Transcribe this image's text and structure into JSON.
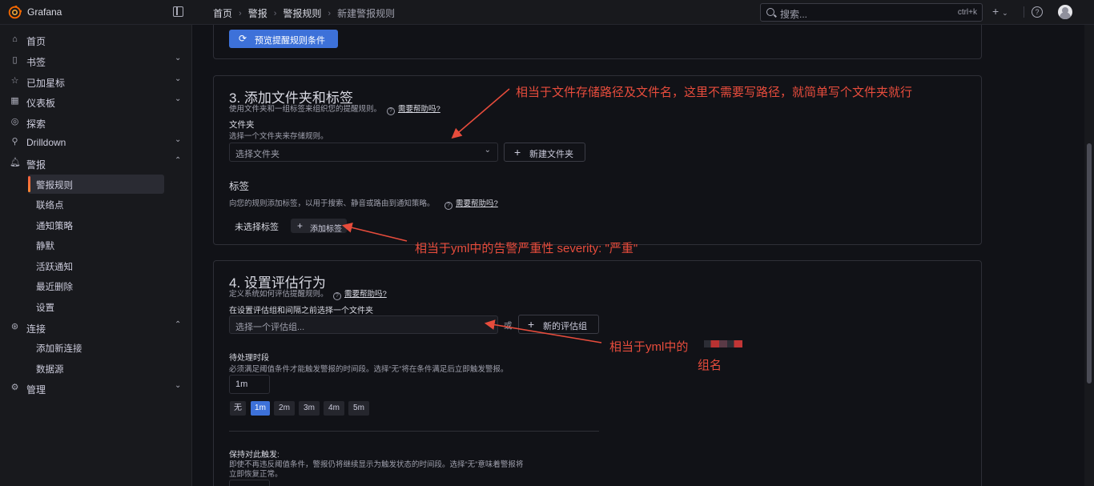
{
  "topbar": {
    "brand": "Grafana",
    "breadcrumb": [
      "首页",
      "警报",
      "警报规则",
      "新建警报规则"
    ],
    "search_placeholder": "搜索...",
    "search_shortcut": "ctrl+k",
    "plus_label": "+",
    "help_label": "?"
  },
  "sidebar": {
    "items": [
      {
        "label": "首页",
        "icon": "home-icon"
      },
      {
        "label": "书签",
        "icon": "bookmark-icon"
      },
      {
        "label": "已加星标",
        "icon": "star-icon"
      },
      {
        "label": "仪表板",
        "icon": "dashboard-icon"
      },
      {
        "label": "探索",
        "icon": "compass-icon"
      },
      {
        "label": "Drilldown",
        "icon": "drilldown-icon"
      },
      {
        "label": "警报",
        "icon": "bell-icon"
      },
      {
        "label": "连接",
        "icon": "connection-icon"
      },
      {
        "label": "管理",
        "icon": "gear-icon"
      }
    ],
    "alert_children": [
      "警报规则",
      "联络点",
      "通知策略",
      "静默",
      "活跃通知",
      "最近删除",
      "设置"
    ],
    "connection_children": [
      "添加新连接",
      "数据源"
    ]
  },
  "preview_button": "预览提醒规则条件",
  "section3": {
    "title": "3. 添加文件夹和标签",
    "desc": "使用文件夹和一组标签来组织您的提醒规则。",
    "need_help": "需要帮助吗?",
    "folder_label": "文件夹",
    "folder_desc": "选择一个文件夹来存储规则。",
    "folder_placeholder": "选择文件夹",
    "new_folder": "新建文件夹",
    "labels_title": "标签",
    "labels_desc": "向您的规则添加标签，以用于搜索、静音或路由到通知策略。",
    "labels_need_help": "需要帮助吗?",
    "no_labels": "未选择标签",
    "add_label": "添加标签"
  },
  "section4": {
    "title": "4. 设置评估行为",
    "desc": "定义系统如何评估提醒规则。",
    "need_help": "需要帮助吗?",
    "group_hint": "在设置评估组和间隔之前选择一个文件夹",
    "group_placeholder": "选择一个评估组...",
    "or": "或",
    "new_group": "新的评估组",
    "pending_label": "待处理时段",
    "pending_desc": "必须满足阈值条件才能触发警报的时间段。选择“无”将在条件满足后立即触发警报。",
    "pending_value": "1m",
    "pending_options": [
      "无",
      "1m",
      "2m",
      "3m",
      "4m",
      "5m"
    ],
    "pending_selected": "1m",
    "keep_label": "保持对此触发:",
    "keep_desc_1": "即使不再违反阈值条件，警报仍将继续显示为触发状态的时间段。选择“无”意味着警报将",
    "keep_desc_2": "立即恢复正常。"
  },
  "annotations": {
    "folder_note": "相当于文件存储路径及文件名，这里不需要写路径，就简单写个文件夹就行",
    "label_note": "相当于yml中的告警严重性 severity: \"严重\"",
    "group_note_1": "相当于yml中的",
    "group_note_2": "组名"
  },
  "colors": {
    "annotation": "#e74c3c",
    "primary": "#3d71d9",
    "accent": "#f55f3e"
  }
}
